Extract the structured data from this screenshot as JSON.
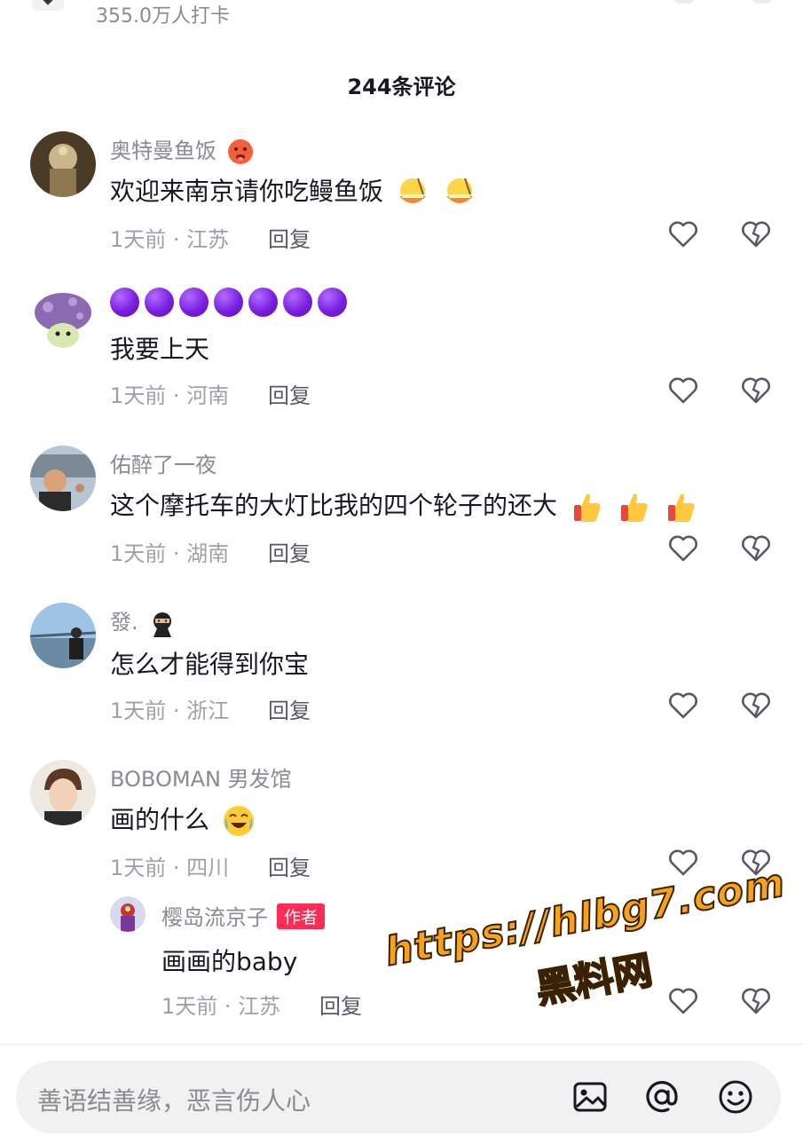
{
  "header": {
    "checkin_count": "355.0万人打卡",
    "comment_count": "244条评论"
  },
  "comments": [
    {
      "username": "奥特曼鱼饭",
      "username_emoji": "hot-face-emoji",
      "text": "欢迎来南京请你吃鳗鱼饭",
      "text_emojis": [
        "ramen-bowl-emoji",
        "ramen-bowl-emoji"
      ],
      "time_location": "1天前 · 江苏",
      "reply_label": "回复"
    },
    {
      "username": "",
      "username_emoji": "purple-circle-emoji x7",
      "text": "我要上天",
      "time_location": "1天前 · 河南",
      "reply_label": "回复"
    },
    {
      "username": "佑醉了一夜",
      "text": "这个摩托车的大灯比我的四个轮子的还大",
      "text_emojis": [
        "thumbs-up-emoji",
        "thumbs-up-emoji",
        "thumbs-up-emoji"
      ],
      "time_location": "1天前 · 湖南",
      "reply_label": "回复"
    },
    {
      "username": "發.",
      "username_emoji": "ninja-emoji",
      "text": "怎么才能得到你宝",
      "time_location": "1天前 · 浙江",
      "reply_label": "回复"
    },
    {
      "username": "BOBOMAN 男发馆",
      "text": "画的什么",
      "text_emojis": [
        "crying-laughing-emoji"
      ],
      "time_location": "1天前 · 四川",
      "reply_label": "回复"
    }
  ],
  "reply": {
    "username": "樱岛流京子",
    "badge": "作者",
    "text": "画画的baby",
    "time_location": "1天前 · 江苏",
    "reply_label": "回复"
  },
  "watermark": {
    "url": "https://hlbg7.com",
    "site": "黑料网"
  },
  "input": {
    "placeholder": "善语结善缘，恶言伤人心",
    "icons": [
      "image-icon",
      "at-icon",
      "emoji-icon"
    ]
  },
  "colors": {
    "text_primary": "#161823",
    "text_secondary": "#8a8b91",
    "author_badge": "#fe2c55",
    "watermark": "#f7a21b",
    "input_bg": "#f1f1f2"
  }
}
